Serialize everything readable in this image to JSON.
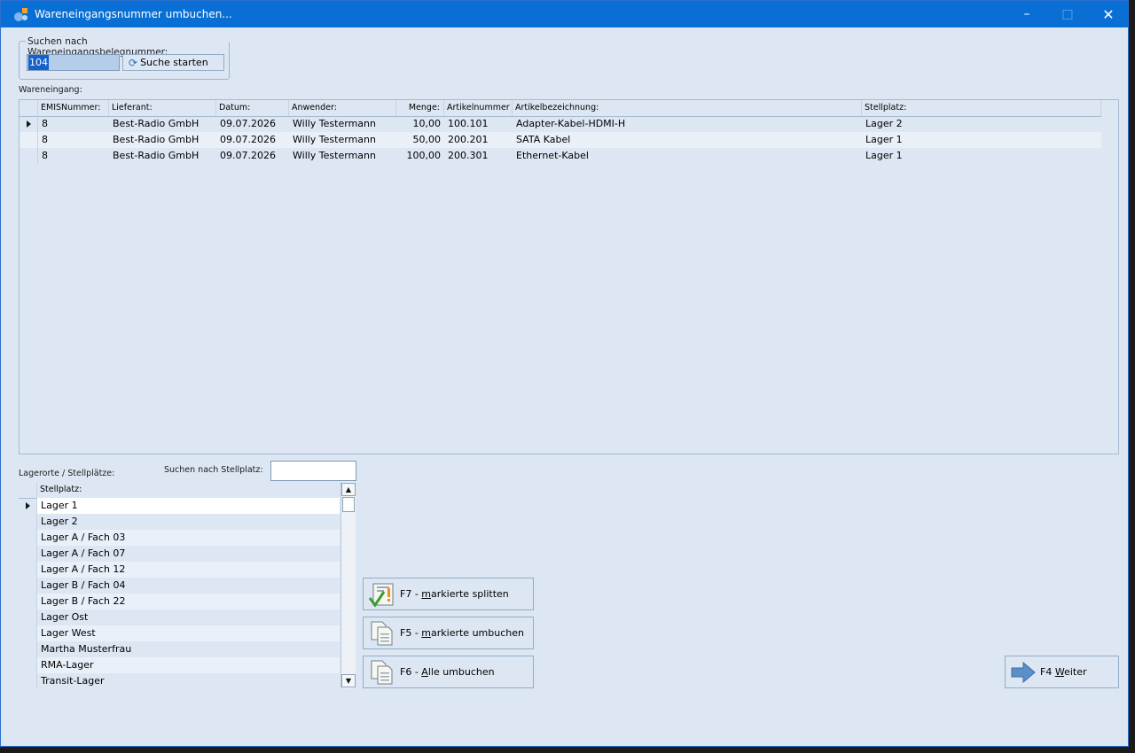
{
  "window": {
    "title": "Wareneingangsnummer umbuchen..."
  },
  "search": {
    "group_label": "Suchen nach Wareneingangsbelegnummer:",
    "value": "104",
    "button_label": "Suche starten"
  },
  "wareneingang": {
    "label": "Wareneingang:",
    "columns": [
      "EMISNummer:",
      "Lieferant:",
      "Datum:",
      "Anwender:",
      "Menge:",
      "Artikelnummer",
      "Artikelbezeichnung:",
      "Stellplatz:"
    ],
    "rows": [
      [
        "8",
        "Best-Radio GmbH",
        "09.07.2026",
        "Willy Testermann",
        "10,00",
        "100.101",
        "Adapter-Kabel-HDMI-H",
        "Lager 2"
      ],
      [
        "8",
        "Best-Radio GmbH",
        "09.07.2026",
        "Willy Testermann",
        "50,00",
        "200.201",
        "SATA Kabel",
        "Lager 1"
      ],
      [
        "8",
        "Best-Radio GmbH",
        "09.07.2026",
        "Willy Testermann",
        "100,00",
        "200.301",
        "Ethernet-Kabel",
        "Lager 1"
      ]
    ]
  },
  "lagerorte": {
    "label": "Lagerorte / Stellplätze:",
    "search_label": "Suchen nach Stellplatz:",
    "search_value": "",
    "column": "Stellplatz:",
    "items": [
      "Lager 1",
      "Lager 2",
      "Lager A / Fach 03",
      "Lager A / Fach 07",
      "Lager A / Fach 12",
      "Lager B / Fach 04",
      "Lager B / Fach 22",
      "Lager Ost",
      "Lager West",
      "Martha Musterfrau",
      "RMA-Lager",
      "Transit-Lager"
    ]
  },
  "actions": {
    "split": {
      "prefix": "F7 - ",
      "mnemonic": "m",
      "rest": "arkierte splitten"
    },
    "umbuchen": {
      "prefix": "F5 - ",
      "mnemonic": "m",
      "rest": "arkierte umbuchen"
    },
    "alle": {
      "prefix": "F6 - ",
      "mnemonic": "A",
      "rest": "lle umbuchen"
    },
    "weiter": {
      "prefix": "F4 ",
      "mnemonic": "W",
      "rest": "eiter"
    }
  },
  "icons": [
    "app-icon",
    "refresh-icon",
    "split-check-icon",
    "documents-icon",
    "arrow-right-icon"
  ],
  "colors": {
    "titlebar": "#0a6fd4",
    "background": "#dde7f3",
    "selection": "#1560c9"
  }
}
